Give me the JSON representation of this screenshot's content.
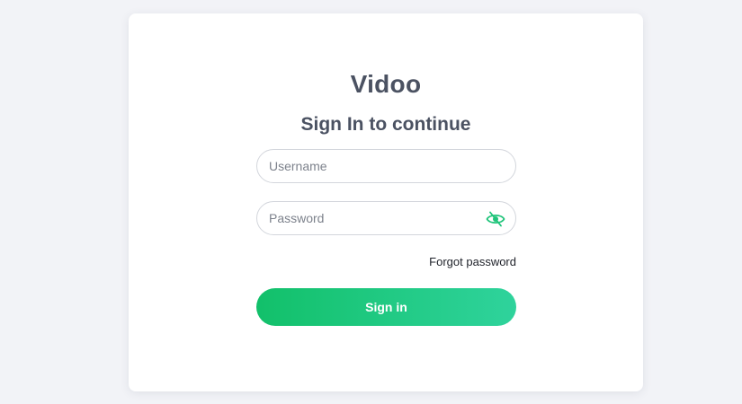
{
  "app": {
    "name": "Vidoo"
  },
  "login": {
    "subtitle": "Sign In to continue",
    "username": {
      "placeholder": "Username",
      "value": ""
    },
    "password": {
      "placeholder": "Password",
      "value": "",
      "toggle_icon": "eye-slash-icon"
    },
    "forgot_password_label": "Forgot password",
    "submit_label": "Sign in"
  },
  "colors": {
    "background": "#f2f3f7",
    "card": "#ffffff",
    "text": "#4b5262",
    "accent_start": "#12c06a",
    "accent_end": "#2fd39c",
    "icon": "#1fc47a"
  }
}
